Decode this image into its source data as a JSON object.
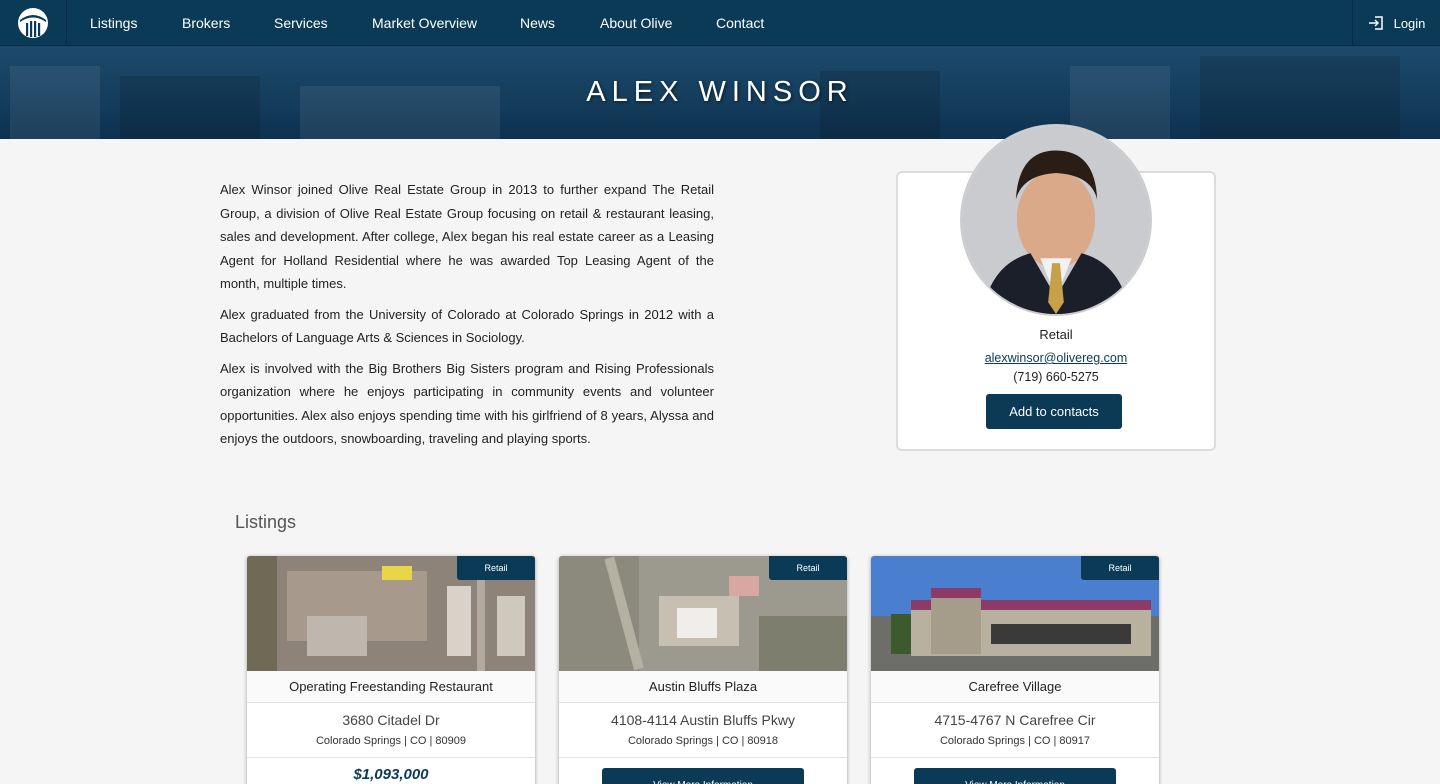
{
  "nav": {
    "items": [
      "Listings",
      "Brokers",
      "Services",
      "Market Overview",
      "News",
      "About Olive",
      "Contact"
    ],
    "login_label": "Login"
  },
  "hero": {
    "title": "ALEX WINSOR"
  },
  "bio": {
    "paragraphs": [
      "Alex Winsor joined Olive Real Estate Group in 2013 to further expand The Retail Group, a division of Olive Real Estate Group focusing on retail & restaurant leasing, sales and development. After college, Alex began his real estate career as a Leasing Agent for Holland Residential where he was awarded Top Leasing Agent of the month, multiple times.",
      "Alex graduated from the University of Colorado at Colorado Springs in 2012 with a Bachelors of Language Arts & Sciences in Sociology.",
      "Alex is involved with the Big Brothers Big Sisters program and Rising Professionals organization where he enjoys participating in community events and volunteer opportunities. Alex also enjoys spending time with his girlfriend of 8 years, Alyssa and enjoys the outdoors, snowboarding, traveling and playing sports."
    ]
  },
  "profile": {
    "department": "Retail",
    "email": "alexwinsor@olivereg.com",
    "phone": "(719) 660-5275",
    "add_contacts_label": "Add to contacts"
  },
  "listings": {
    "title": "Listings",
    "cards": [
      {
        "tag": "Retail",
        "name": "Operating Freestanding Restaurant",
        "address": "3680 Citadel Dr",
        "city": "Colorado Springs | CO | 80909",
        "price": "$1,093,000",
        "button": ""
      },
      {
        "tag": "Retail",
        "name": "Austin Bluffs Plaza",
        "address": "4108-4114 Austin Bluffs Pkwy",
        "city": "Colorado Springs | CO | 80918",
        "price": "",
        "button": "View More Information"
      },
      {
        "tag": "Retail",
        "name": "Carefree Village",
        "address": "4715-4767 N Carefree Cir",
        "city": "Colorado Springs | CO | 80917",
        "price": "",
        "button": "View More Information"
      }
    ]
  },
  "colors": {
    "brand": "#0b3a57",
    "background": "#f5f5f5"
  },
  "icons": {
    "logo": "olive-logo-icon",
    "login": "login-icon"
  }
}
